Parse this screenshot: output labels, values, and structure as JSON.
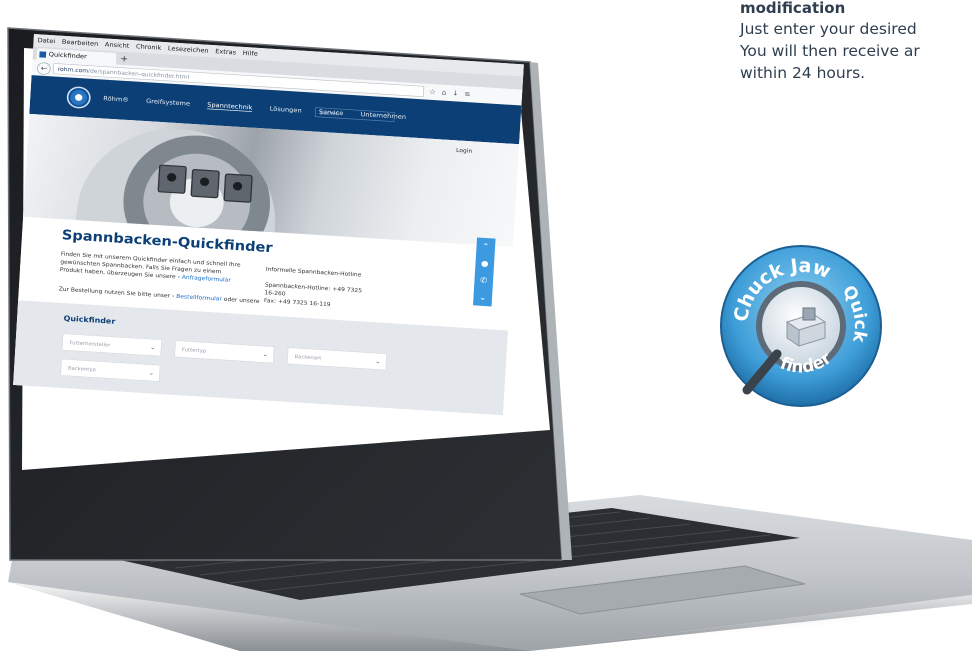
{
  "copy": {
    "heading": "modification",
    "lines": [
      "Just enter your desired",
      "You will then receive ar",
      "within 24 hours."
    ]
  },
  "browser": {
    "menu": [
      "Datei",
      "Bearbeiten",
      "Ansicht",
      "Chronik",
      "Lesezeichen",
      "Extras",
      "Hilfe"
    ],
    "tab_title": "Quickfinder",
    "url_host": "rohm.com",
    "url_path": "/de/spannbacken-quickfinder.html"
  },
  "site": {
    "nav": [
      "Röhm®",
      "Greifsysteme",
      "Spanntechnik",
      "Lösungen",
      "Service",
      "Unternehmen"
    ],
    "search_placeholder": "Suchen",
    "lang": "Login",
    "title": "Spannbacken-Quickfinder",
    "body": "Finden Sie mit unserem Quickfinder einfach und schnell Ihre gewünschten Spannbacken. Falls Sie Fragen zu einem Produkt haben, überzeugen Sie unsere",
    "body_link": "› Anfrageformular",
    "order_text": "Zur Bestellung nutzen Sie bitte unser",
    "order_link": "› Bestellformular",
    "order_tail": "oder unsere",
    "hotline_title": "Informelle Spannbacken-Hotline",
    "hotline_lines": [
      "Spannbacken-Hotline: +49 7325 16-260",
      "Fax: +49 7325 16-119"
    ],
    "finder_title": "Quickfinder",
    "selects": [
      "Futterhersteller",
      "Futtertyp",
      "Backenart",
      "Backentyp"
    ]
  },
  "badge": {
    "arc_top": "Chuck Jaw",
    "arc_right": "Quick",
    "arc_bottom": "finder"
  },
  "colors": {
    "brand_navy": "#0b3f76",
    "accent_blue": "#3c9be0",
    "text_dark": "#2e3e4f"
  }
}
